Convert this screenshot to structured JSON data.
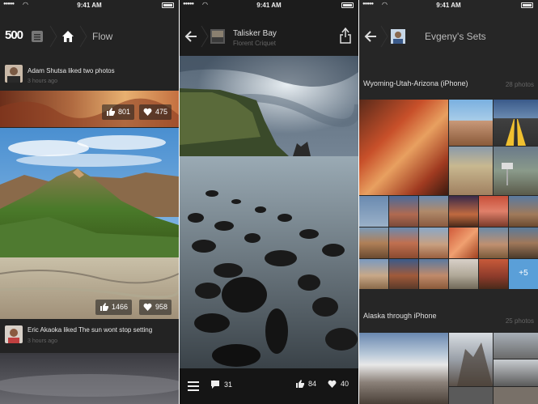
{
  "status": {
    "time": "9:41 AM"
  },
  "flow": {
    "logo": "500",
    "title": "Flow",
    "items": [
      {
        "user_text": "Adam Shutsa liked two photos",
        "time": "3 hours ago"
      },
      {
        "user_text": "Eric Akaoka liked The sun wont stop setting",
        "time": "3 hours ago"
      }
    ],
    "stats_top": {
      "views": "801",
      "likes": "475"
    },
    "stats_main": {
      "views": "1466",
      "likes": "958"
    }
  },
  "photo": {
    "title": "Talisker Bay",
    "author": "Florent Criquet",
    "comments": "31",
    "views": "84",
    "likes": "40"
  },
  "sets": {
    "title": "Evgeny's Sets",
    "set1": {
      "name": "Wyoming-Utah-Arizona (iPhone)",
      "count": "28 photos",
      "more": "+5"
    },
    "set2": {
      "name": "Alaska through iPhone",
      "count": "25 photos"
    }
  },
  "colors": {
    "accent_blue": "#5a9fd8",
    "bar_bg": "#151515"
  }
}
